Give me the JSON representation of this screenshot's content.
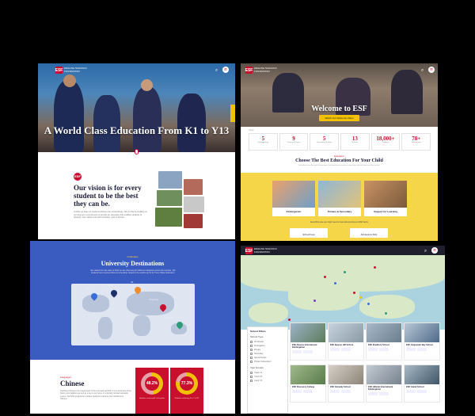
{
  "colors": {
    "brand_red": "#c8102e",
    "brand_yellow": "#f2c200",
    "uni_blue": "#3a5bbf",
    "navy": "#1c1c3a"
  },
  "brand": {
    "logo_letters": "ESF",
    "logo_text": "ENGLISH SCHOOLS FOUNDATION"
  },
  "hero": {
    "title": "A World Class Education From K1 to Y13",
    "vision_title": "Our vision is for every student to be the best they can be.",
    "vision_body": "At ESF we help our students achieve the extraordinary. We do this by building on our long-term commitment to provide an education that enables students to develop, their values and self-motivation, and to flourish.",
    "search_icon": "search-icon",
    "menu_icon": "menu-icon"
  },
  "welcome": {
    "title": "Welcome to ESF",
    "button_label": "Watch Our Welcome Video",
    "breadcrumb": "Home",
    "stats": [
      {
        "num": "5",
        "label": "Kindergartens"
      },
      {
        "num": "9",
        "label": "Primary Schools"
      },
      {
        "num": "5",
        "label": "Secondary Schools"
      },
      {
        "num": "13",
        "label": "Schools"
      },
      {
        "num": "18,000+",
        "label": "Students"
      },
      {
        "num": "78+",
        "label": "Nationalities"
      }
    ],
    "kicker": "Education",
    "heading": "Choose The Best Education For Your Child",
    "sub": "We believe that the goal of education is to develop and nurture every child to be the best that they can be.",
    "cards": [
      {
        "label": "Kindergarten"
      },
      {
        "label": "Primary & Secondary"
      },
      {
        "label": "Support for Learning"
      }
    ],
    "note": "Everything else you might need to know about joining our ESF family",
    "links": [
      {
        "label": "School Fees"
      },
      {
        "label": "Admissions FAQ"
      }
    ]
  },
  "university": {
    "kicker": "Graduates",
    "title": "University Destinations",
    "sub": "We started from the class of 2021 we are observing 221 different institutions across 18 countries. 101 students have received offers at universities ranked in the world's top 50 by Times Higher Education.",
    "pins": [
      {
        "label": "USA"
      },
      {
        "label": "Canada"
      },
      {
        "label": "UK"
      },
      {
        "label": "Hong Kong"
      },
      {
        "label": "Australia"
      }
    ]
  },
  "chinese": {
    "kicker": "Languages",
    "title": "Chinese",
    "body": "Teaching Chinese is an integral part of the curriculum at ESF. It is an important of our history and traditions as well as a key to our future in a globally minded education system. Our ESF programme enables students to achieve their ambitions in Chinese.",
    "stats": [
      {
        "value": "48.2%",
        "fraction": 0.482,
        "desc": "Students receiving A* to B grades"
      },
      {
        "value": "77.3%",
        "fraction": 0.773,
        "desc": "Students achieving 5 to 7 in DP"
      }
    ]
  },
  "schools": {
    "filter_title": "School Filters",
    "filter_groups": [
      {
        "heading": "School Type",
        "items": [
          "All Schools",
          "Kindergarten",
          "Primary",
          "Secondary",
          "Special Needs",
          "Private Independent"
        ]
      },
      {
        "heading": "Year Groups",
        "items": [
          "Years 1-3",
          "Years 4-6",
          "Years 7-9"
        ]
      }
    ],
    "list": [
      {
        "name": "ESF Abacus International Kindergarten"
      },
      {
        "name": "ESF Beacon Hill School"
      },
      {
        "name": "ESF Bradbury School"
      },
      {
        "name": "ESF Clearwater Bay School"
      },
      {
        "name": "ESF Discovery College"
      },
      {
        "name": "ESF Glenealy School"
      },
      {
        "name": "ESF Hillside International Kindergarten"
      },
      {
        "name": "ESF Island School"
      }
    ]
  }
}
